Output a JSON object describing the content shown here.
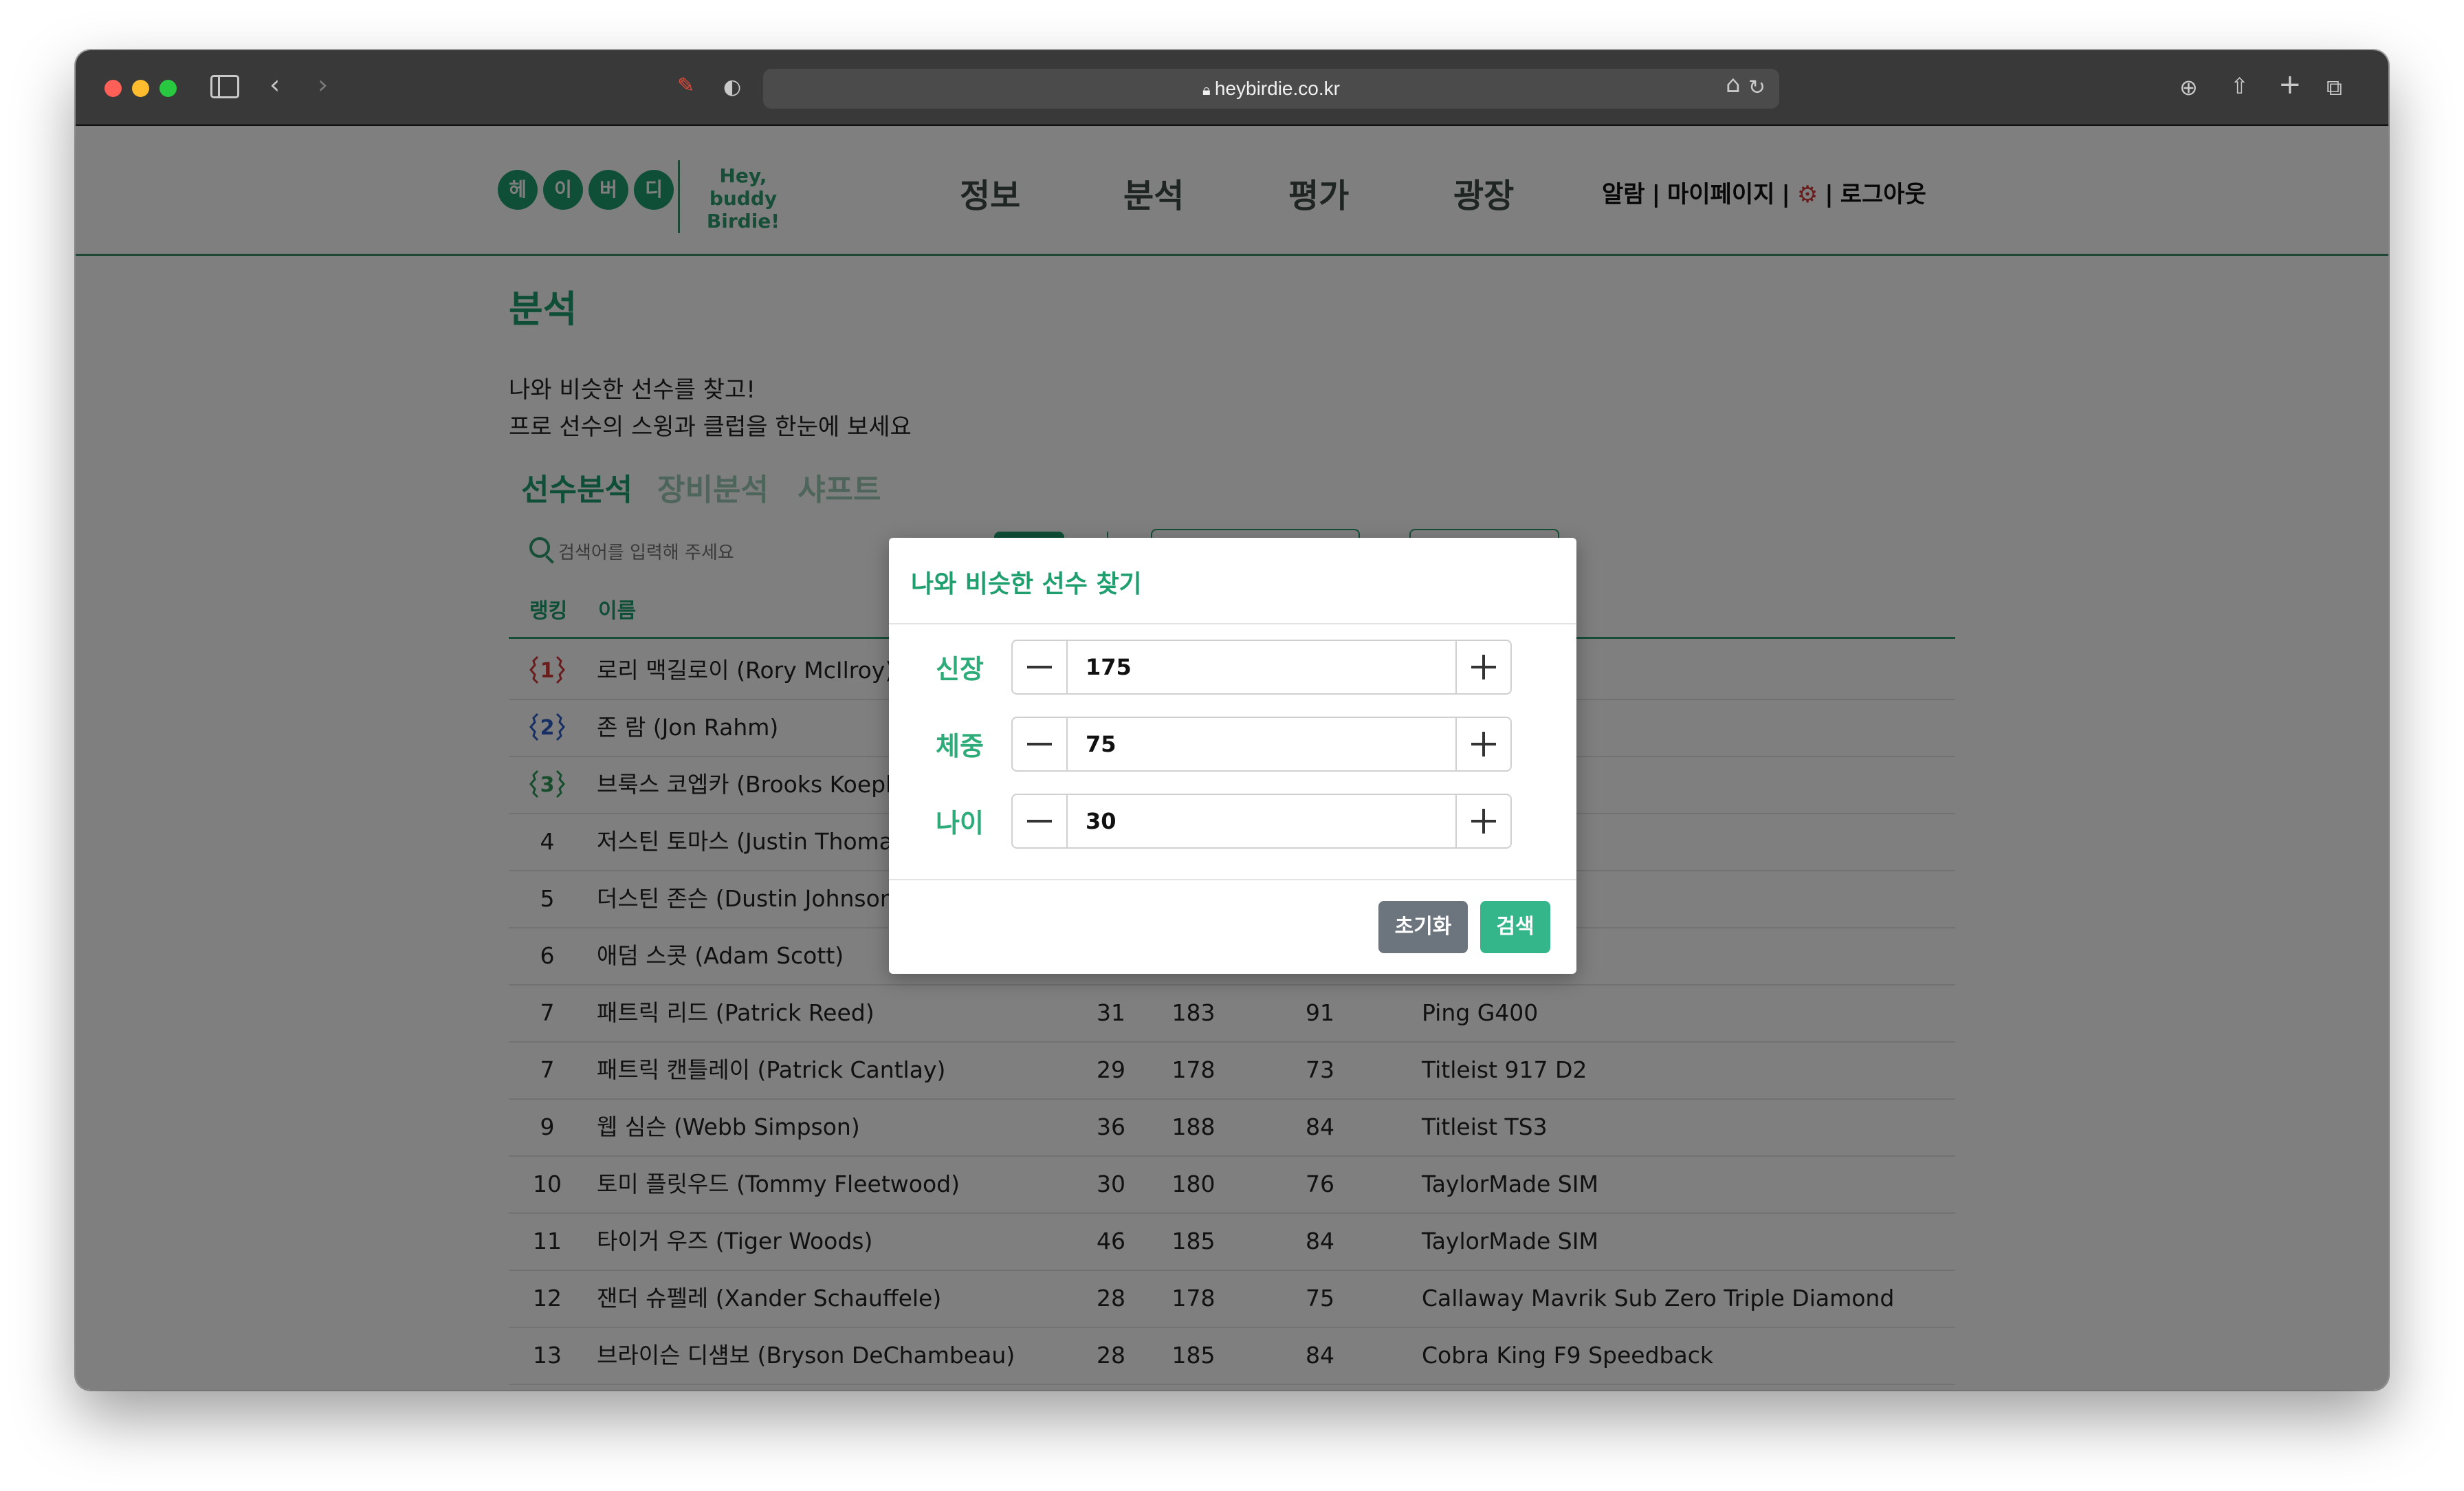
{
  "browser": {
    "url": "heybirdie.co.kr"
  },
  "logo": {
    "chars": [
      "헤",
      "이",
      "버",
      "디"
    ],
    "tagline_line1": "Hey, buddy",
    "tagline_line2": "Birdie!"
  },
  "nav": {
    "items": [
      "정보",
      "분석",
      "평가",
      "광장"
    ]
  },
  "utility": {
    "alarm": "알람",
    "mypage": "마이페이지",
    "logout": "로그아웃",
    "separator": "|",
    "gear_icon": "gear-icon"
  },
  "page": {
    "title": "분석",
    "desc_line1": "나와 비슷한 선수를 찾고!",
    "desc_line2": "프로 선수의 스윙과 클럽을 한눈에 보세요"
  },
  "tabs": [
    "선수분석",
    "장비분석",
    "샤프트"
  ],
  "search": {
    "placeholder": "검색어를 입력해 주세요"
  },
  "table": {
    "headers": {
      "rank": "랭킹",
      "name": "이름"
    },
    "rows": [
      {
        "rank": "1",
        "name": "로리 맥길로이 (Rory McIlroy)",
        "age": "",
        "height": "",
        "weight": "",
        "club": ""
      },
      {
        "rank": "2",
        "name": "존 람 (Jon Rahm)",
        "age": "",
        "height": "",
        "weight": "",
        "club": ""
      },
      {
        "rank": "3",
        "name": "브룩스 코엡카 (Brooks Koepka)",
        "age": "",
        "height": "",
        "weight": "",
        "club": ""
      },
      {
        "rank": "4",
        "name": "저스틴 토마스 (Justin Thomas)",
        "age": "",
        "height": "",
        "weight": "",
        "club": ""
      },
      {
        "rank": "5",
        "name": "더스틴 존슨 (Dustin Johnson)",
        "age": "",
        "height": "",
        "weight": "",
        "club": ""
      },
      {
        "rank": "6",
        "name": "애덤 스콧 (Adam Scott)",
        "age": "",
        "height": "",
        "weight": "",
        "club": ""
      },
      {
        "rank": "7",
        "name": "패트릭 리드 (Patrick Reed)",
        "age": "31",
        "height": "183",
        "weight": "91",
        "club": "Ping G400"
      },
      {
        "rank": "7",
        "name": "패트릭 캔틀레이 (Patrick Cantlay)",
        "age": "29",
        "height": "178",
        "weight": "73",
        "club": "Titleist 917 D2"
      },
      {
        "rank": "9",
        "name": "웹 심슨 (Webb Simpson)",
        "age": "36",
        "height": "188",
        "weight": "84",
        "club": "Titleist TS3"
      },
      {
        "rank": "10",
        "name": "토미 플릿우드 (Tommy Fleetwood)",
        "age": "30",
        "height": "180",
        "weight": "76",
        "club": "TaylorMade SIM"
      },
      {
        "rank": "11",
        "name": "타이거 우즈 (Tiger Woods)",
        "age": "46",
        "height": "185",
        "weight": "84",
        "club": "TaylorMade SIM"
      },
      {
        "rank": "12",
        "name": "잰더 슈펠레 (Xander Schauffele)",
        "age": "28",
        "height": "178",
        "weight": "75",
        "club": "Callaway Mavrik Sub Zero Triple Diamond"
      },
      {
        "rank": "13",
        "name": "브라이슨 디섐보 (Bryson DeChambeau)",
        "age": "28",
        "height": "185",
        "weight": "84",
        "club": "Cobra King F9 Speedback"
      }
    ],
    "medal_colors": [
      "#d23a3a",
      "#2f5fc4",
      "#2f9a5a"
    ]
  },
  "modal": {
    "title": "나와 비슷한 선수 찾기",
    "fields": [
      {
        "label": "신장",
        "value": "175"
      },
      {
        "label": "체중",
        "value": "75"
      },
      {
        "label": "나이",
        "value": "30"
      }
    ],
    "reset_label": "초기화",
    "search_label": "검색"
  },
  "colors": {
    "brand_green": "#1f9e6e",
    "reset_gray": "#6c757d",
    "search_green": "#34b58a"
  }
}
